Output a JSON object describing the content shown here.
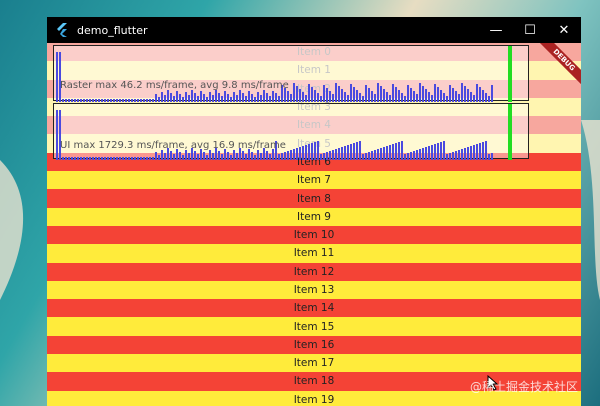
{
  "window": {
    "title": "demo_flutter",
    "minimize_glyph": "—",
    "maximize_glyph": "☐",
    "close_glyph": "✕"
  },
  "debug_banner": "DEBUG",
  "perf": {
    "raster_label": "Raster  max 46.2 ms/frame, avg 9.8 ms/frame",
    "ui_label": "UI  max 1729.3 ms/frame, avg 16.9 ms/frame"
  },
  "items": [
    "Item 0",
    "Item 1",
    "Item 2",
    "Item 3",
    "Item 4",
    "Item 5",
    "Item 6",
    "Item 7",
    "Item 8",
    "Item 9",
    "Item 10",
    "Item 11",
    "Item 12",
    "Item 13",
    "Item 14",
    "Item 15",
    "Item 16",
    "Item 17",
    "Item 18",
    "Item 19"
  ],
  "watermark": "@稀土掘金技术社区",
  "colors": {
    "row_a": "#ffeb3b",
    "row_b": "#f44336",
    "bar": "#4a4adf",
    "frame_marker": "#22dd22"
  }
}
